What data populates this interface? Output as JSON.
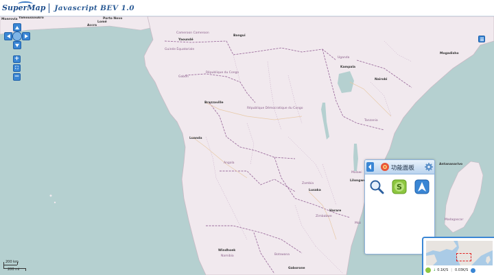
{
  "header": {
    "logo_text": "SuperMap",
    "app_title": "Javascript BEV 1.0"
  },
  "map": {
    "places": [
      {
        "name": "Monrovia",
        "kind": "city"
      },
      {
        "name": "Yamoussoukro",
        "kind": "city"
      },
      {
        "name": "Porto Novo",
        "kind": "city"
      },
      {
        "name": "Lomé",
        "kind": "city"
      },
      {
        "name": "Accra",
        "kind": "city"
      },
      {
        "name": "Cameroon Cameroon",
        "kind": "country"
      },
      {
        "name": "Yaoundé",
        "kind": "city"
      },
      {
        "name": "Bangui",
        "kind": "city"
      },
      {
        "name": "Guinée Équatoriale",
        "kind": "country"
      },
      {
        "name": "Gabon",
        "kind": "country"
      },
      {
        "name": "République du Congo",
        "kind": "country"
      },
      {
        "name": "Brazzaville",
        "kind": "city"
      },
      {
        "name": "République Démocratique du Congo",
        "kind": "country"
      },
      {
        "name": "Uganda",
        "kind": "country"
      },
      {
        "name": "Kampala",
        "kind": "city"
      },
      {
        "name": "Nairobi",
        "kind": "city"
      },
      {
        "name": "Mogadisho",
        "kind": "city"
      },
      {
        "name": "Tanzania",
        "kind": "country"
      },
      {
        "name": "Luanda",
        "kind": "city"
      },
      {
        "name": "Angola",
        "kind": "country"
      },
      {
        "name": "Zambia",
        "kind": "country"
      },
      {
        "name": "Lusaka",
        "kind": "city"
      },
      {
        "name": "Lilongwe",
        "kind": "city"
      },
      {
        "name": "Malawi",
        "kind": "country"
      },
      {
        "name": "Harare",
        "kind": "city"
      },
      {
        "name": "Zimbabwe",
        "kind": "country"
      },
      {
        "name": "Windhoek",
        "kind": "city"
      },
      {
        "name": "Namibia",
        "kind": "country"
      },
      {
        "name": "Botswana",
        "kind": "country"
      },
      {
        "name": "Gaborone",
        "kind": "city"
      },
      {
        "name": "Moz",
        "kind": "country"
      },
      {
        "name": "Madagascar",
        "kind": "country"
      },
      {
        "name": "Antananarivo",
        "kind": "city"
      }
    ]
  },
  "nav": {
    "pan_up": "pan up",
    "pan_down": "pan down",
    "pan_left": "pan left",
    "pan_right": "pan right",
    "zoom_in_label": "+",
    "zoom_max_label": "⛶",
    "zoom_out_label": "−"
  },
  "panel": {
    "title": "功能面板",
    "icons": [
      "chevron-left-icon",
      "panel-logo-icon",
      "gear-icon",
      "search-icon",
      "s-logo-icon",
      "navigation-arrow-icon"
    ]
  },
  "scale": {
    "top_label": "200 km",
    "bottom_label": "200 mi"
  },
  "overview": {
    "speed_down": "0.1K/S",
    "speed_up": "0.03K/S"
  },
  "colors": {
    "land": "#f1e9ee",
    "water": "#b5d0d0",
    "border": "#9d6f9e",
    "accent": "#3a86d4"
  }
}
